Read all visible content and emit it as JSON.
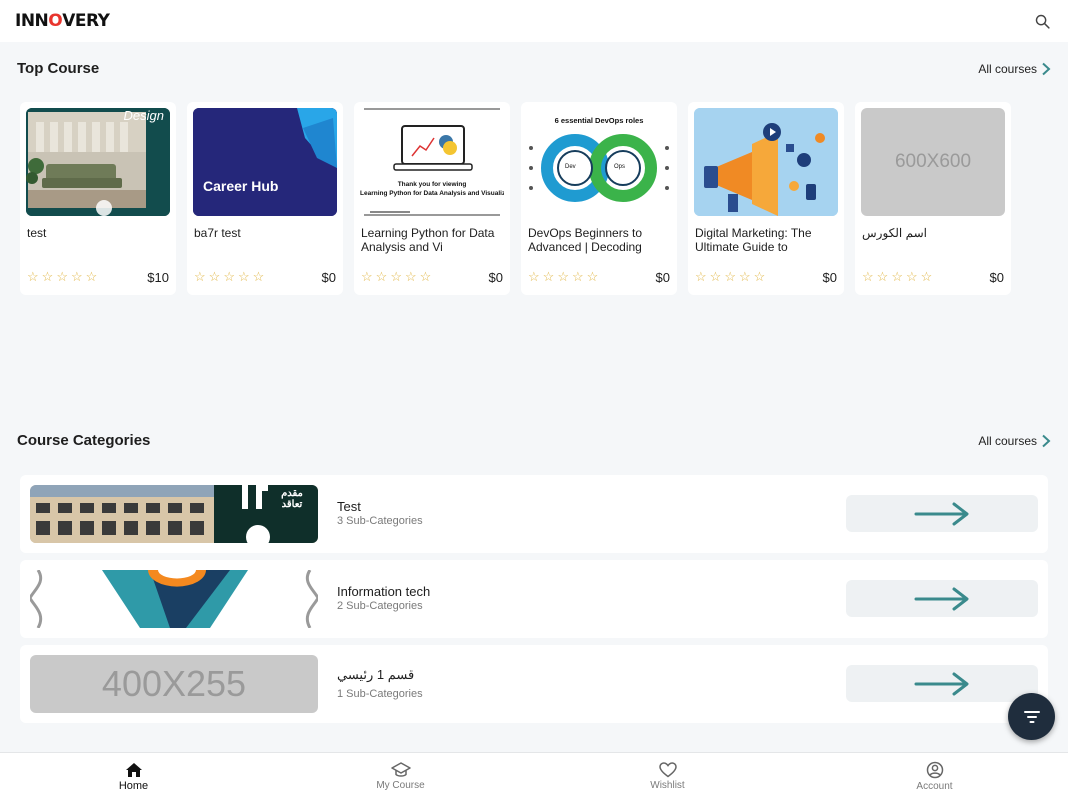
{
  "header": {
    "logo_text_1": "INN",
    "logo_text_2": "O",
    "logo_text_3": "VERY",
    "search_icon": "search-icon"
  },
  "top_course": {
    "title": "Top Course",
    "all_link": "All courses",
    "cards": [
      {
        "title": "test",
        "price": "$10",
        "stars": 5,
        "thumb_text": "Design"
      },
      {
        "title": "ba7r test",
        "price": "$0",
        "stars": 5,
        "thumb_text": "Career Hub"
      },
      {
        "title": "Learning Python for Data Analysis and Vi",
        "price": "$0",
        "stars": 5,
        "thumb_text_1": "Thank you for viewing",
        "thumb_text_2": "Learning Python for Data Analysis and Visualiz"
      },
      {
        "title": "DevOps Beginners to Advanced | Decoding",
        "price": "$0",
        "stars": 5,
        "thumb_text": "6 essential DevOps roles",
        "dev": "Dev",
        "ops": "Ops"
      },
      {
        "title": "Digital Marketing: The Ultimate Guide to",
        "price": "$0",
        "stars": 5
      },
      {
        "title": "اسم الكورس",
        "price": "$0",
        "stars": 5,
        "thumb_text": "600X600"
      }
    ]
  },
  "categories": {
    "title": "Course Categories",
    "all_link": "All courses",
    "items": [
      {
        "name": "Test",
        "sub": "3 Sub-Categories",
        "thumb_text": "مقدم تعاقد"
      },
      {
        "name": "Information tech",
        "sub": "2 Sub-Categories"
      },
      {
        "name": "قسم 1 رئيسي",
        "sub": "1 Sub-Categories",
        "thumb_text": "400X255"
      }
    ]
  },
  "bottom_nav": [
    {
      "label": "Home",
      "icon": "home-icon",
      "active": true
    },
    {
      "label": "My Course",
      "icon": "graduation-cap-icon",
      "active": false
    },
    {
      "label": "Wishlist",
      "icon": "heart-icon",
      "active": false
    },
    {
      "label": "Account",
      "icon": "account-icon",
      "active": false
    }
  ],
  "colors": {
    "accent": "#3a8a8c",
    "star": "#e2b84a",
    "fab": "#1f2d3d",
    "logo_red": "#e8352e"
  }
}
